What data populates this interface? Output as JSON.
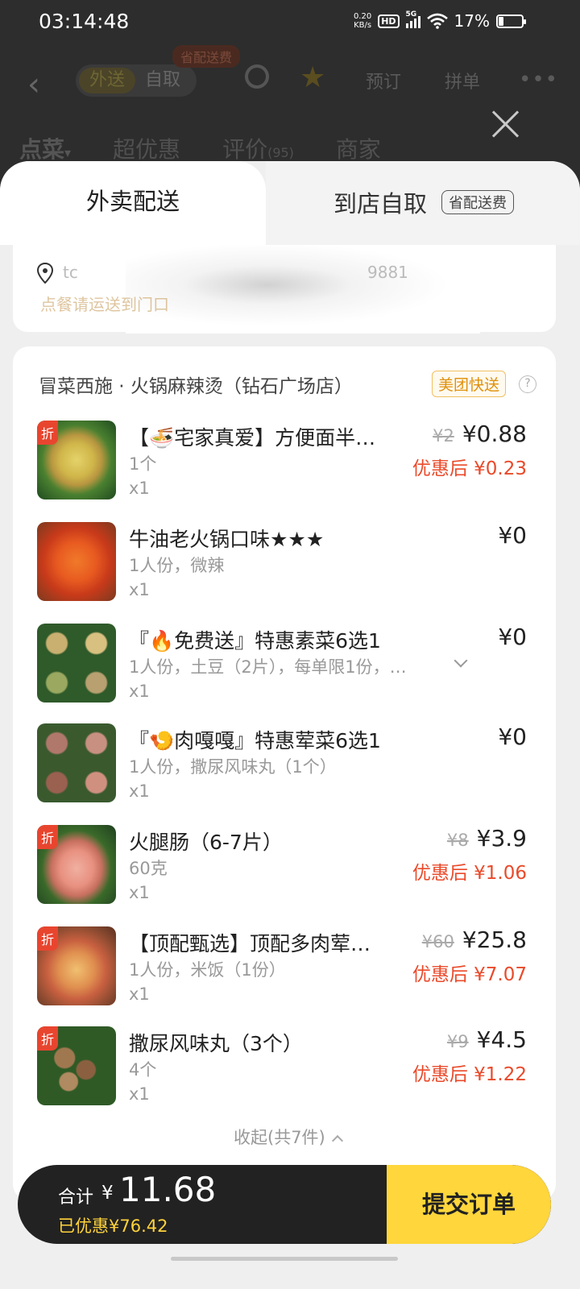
{
  "status_bar": {
    "time": "03:14:48",
    "net_speed_value": "0.20",
    "net_speed_unit": "KB/s",
    "hd": "HD",
    "signal_label": "5G",
    "battery_pct": "17%"
  },
  "background": {
    "mode_active": "外送",
    "mode_other": "自取",
    "badge": "省配送费",
    "reserve": "预订",
    "group": "拼单",
    "more": "•••",
    "tabs": [
      "点菜",
      "超优惠",
      "评价",
      "商家"
    ],
    "tab_sub": "▾",
    "review_count": "(95)"
  },
  "sheet": {
    "tab_delivery": "外卖配送",
    "tab_pickup": "到店自取",
    "pickup_tag": "省配送费",
    "address_partial": "tc",
    "address_tail": "9881",
    "address_tip": "点餐请运送到门口"
  },
  "order": {
    "store": "冒菜西施 · 火锅麻辣烫（钻石广场店）",
    "delivery_badge": "美团快送",
    "help": "?",
    "items": [
      {
        "name": "【🍜宅家真爱】方便面半…",
        "spec": "1个",
        "qty": "x1",
        "orig": "¥2",
        "price": "¥0.88",
        "after": "优惠后 ¥0.23",
        "tag": "折"
      },
      {
        "name": "牛油老火锅口味★★★",
        "spec": "1人份，微辣",
        "qty": "x1",
        "orig": "",
        "price": "¥0",
        "after": "",
        "tag": ""
      },
      {
        "name": "『🔥免费送』特惠素菜6选1",
        "spec": "1人份，土豆（2片），每单限1份，…",
        "qty": "x1",
        "orig": "",
        "price": "¥0",
        "after": "",
        "tag": ""
      },
      {
        "name": "『🍤肉嘎嘎』特惠荤菜6选1",
        "spec": "1人份，撒尿风味丸（1个）",
        "qty": "x1",
        "orig": "",
        "price": "¥0",
        "after": "",
        "tag": ""
      },
      {
        "name": "火腿肠（6-7片）",
        "spec": "60克",
        "qty": "x1",
        "orig": "¥8",
        "price": "¥3.9",
        "after": "优惠后 ¥1.06",
        "tag": "折"
      },
      {
        "name": "【顶配甄选】顶配多肉荤…",
        "spec": "1人份，米饭（1份）",
        "qty": "x1",
        "orig": "¥60",
        "price": "¥25.8",
        "after": "优惠后 ¥7.07",
        "tag": "折"
      },
      {
        "name": "撒尿风味丸（3个）",
        "spec": "4个",
        "qty": "x1",
        "orig": "¥9",
        "price": "¥4.5",
        "after": "优惠后 ¥1.22",
        "tag": "折"
      }
    ],
    "collapse": "收起(共7件)"
  },
  "checkout": {
    "total_label": "合计",
    "currency": "¥",
    "total": "11.68",
    "saved": "已优惠¥76.42",
    "submit": "提交订单"
  },
  "colors": {
    "accent_yellow": "#ffd63b",
    "discount_red": "#ea4a2a",
    "bar_dark": "#222222"
  }
}
